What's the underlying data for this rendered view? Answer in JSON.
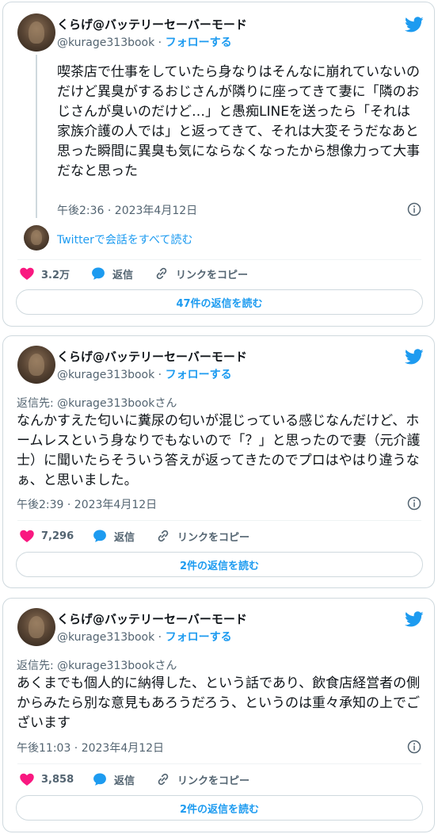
{
  "colors": {
    "accent": "#1d9bf0",
    "like": "#f91880",
    "text": "#0f1419",
    "muted": "#536471",
    "border": "#cfd9de"
  },
  "tweets": [
    {
      "author_name": "くらげ@バッテリーセーバーモード",
      "handle": "@kurage313book",
      "separator": " · ",
      "follow_label": "フォローする",
      "reply_to": "",
      "text": "喫茶店で仕事をしていたら身なりはそんなに崩れていないのだけど異臭がするおじさんが隣りに座ってきて妻に「隣のおじさんが臭いのだけど…」と愚痴LINEを送ったら「それは家族介護の人では」と返ってきて、それは大変そうだなあと思った瞬間に異臭も気にならなくなったから想像力って大事だなと思った",
      "timestamp": "午後2:36 · 2023年4月12日",
      "conversation_link": "Twitterで会話をすべて読む",
      "likes": "3.2万",
      "reply_label": "返信",
      "copy_link_label": "リンクをコピー",
      "read_replies_label": "47件の返信を読む"
    },
    {
      "author_name": "くらげ@バッテリーセーバーモード",
      "handle": "@kurage313book",
      "separator": " · ",
      "follow_label": "フォローする",
      "reply_to": "返信先: @kurage313bookさん",
      "text": "なんかすえた匂いに糞尿の匂いが混じっている感じなんだけど、ホームレスという身なりでもないので「？」と思ったので妻（元介護士）に聞いたらそういう答えが返ってきたのでプロはやはり違うなぁ、と思いました。",
      "timestamp": "午後2:39 · 2023年4月12日",
      "likes": "7,296",
      "reply_label": "返信",
      "copy_link_label": "リンクをコピー",
      "read_replies_label": "2件の返信を読む"
    },
    {
      "author_name": "くらげ@バッテリーセーバーモード",
      "handle": "@kurage313book",
      "separator": " · ",
      "follow_label": "フォローする",
      "reply_to": "返信先: @kurage313bookさん",
      "text": "あくまでも個人的に納得した、という話であり、飲食店経営者の側からみたら別な意見もあろうだろう、というのは重々承知の上でございます",
      "timestamp": "午後11:03 · 2023年4月12日",
      "likes": "3,858",
      "reply_label": "返信",
      "copy_link_label": "リンクをコピー",
      "read_replies_label": "2件の返信を読む"
    }
  ]
}
